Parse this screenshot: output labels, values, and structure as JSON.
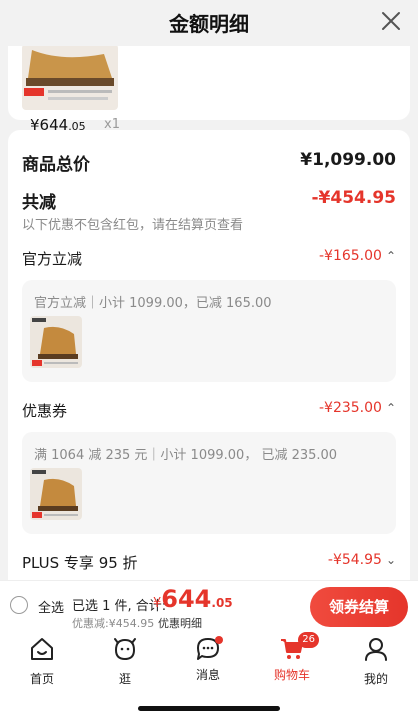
{
  "header": {
    "title": "金额明细",
    "close_icon": "close-icon"
  },
  "top_item": {
    "price_int": "¥644",
    "price_dec": ".05",
    "quantity": "x1"
  },
  "summary": {
    "total_label": "商品总价",
    "total_value": "¥1,099.00",
    "reduce_label": "共减",
    "reduce_value": "-¥454.95",
    "note": "以下优惠不包含红包，请在结算页查看"
  },
  "official": {
    "label": "官方立减",
    "value": "-¥165.00",
    "chevron": "⌃",
    "desc": "官方立减｜小计 1099.00，已减 165.00"
  },
  "coupon": {
    "label": "优惠券",
    "value": "-¥235.00",
    "chevron": "⌃",
    "desc": "满 1064 减 235 元｜小计 1099.00，  已减 235.00"
  },
  "plus": {
    "label": "PLUS 专享 95 折",
    "value": "-¥54.95",
    "chevron": "⌄"
  },
  "bottom_bar": {
    "select_all": "全选",
    "selected": "已选 1 件, 合计:",
    "yen": "¥",
    "amount": "644",
    "amount_dec": ".05",
    "discount": "优惠减:¥454.95",
    "detail": "优惠明细",
    "checkout": "领券结算"
  },
  "tabbar": {
    "items": [
      {
        "label": "首页",
        "icon": "home-icon"
      },
      {
        "label": "逛",
        "icon": "browse-icon"
      },
      {
        "label": "消息",
        "icon": "message-icon"
      },
      {
        "label": "购物车",
        "icon": "cart-icon",
        "badge": "26"
      },
      {
        "label": "我的",
        "icon": "profile-icon"
      }
    ]
  },
  "colors": {
    "accent": "#e5352b",
    "text": "#1a1a1a",
    "muted": "#8a8a8a"
  }
}
